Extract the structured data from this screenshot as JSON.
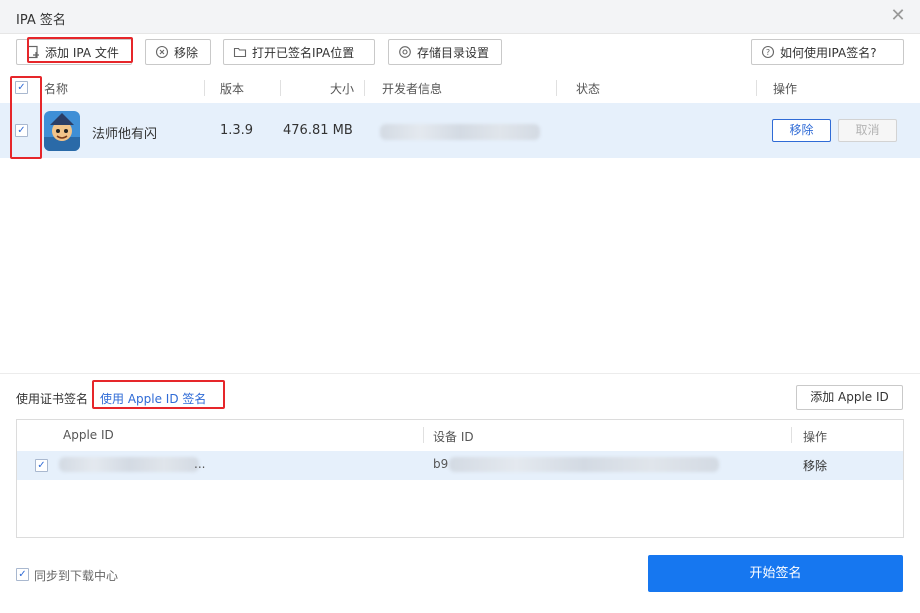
{
  "window": {
    "title": "IPA 签名"
  },
  "toolbar": {
    "add_ipa": "添加 IPA 文件",
    "remove": "移除",
    "open_signed": "打开已签名IPA位置",
    "storage_settings": "存储目录设置",
    "help": "如何使用IPA签名?"
  },
  "table": {
    "columns": [
      "名称",
      "版本",
      "大小",
      "开发者信息",
      "状态",
      "操作"
    ],
    "rows": [
      {
        "name": "法师他有闪",
        "version": "1.3.9",
        "size": "476.81 MB",
        "developer": "",
        "status": "",
        "remove": "移除",
        "cancel": "取消",
        "checked": true
      }
    ]
  },
  "signing": {
    "cert_label": "使用证书签名",
    "appleid_tab": "使用 Apple ID 签名",
    "add_appleid": "添加 Apple ID",
    "columns": [
      "Apple ID",
      "设备 ID",
      "操作"
    ],
    "rows": [
      {
        "apple_id": "...",
        "device_id_visible_start": "b9",
        "action": "移除",
        "checked": true
      }
    ]
  },
  "footer": {
    "sync_label": "同步到下载中心",
    "start": "开始签名"
  },
  "colors": {
    "accent": "#1677f0",
    "highlight": "#e6262a",
    "row_selected": "#e6f0fb"
  },
  "icons": [
    "close-icon",
    "add-file-icon",
    "remove-circle-icon",
    "folder-icon",
    "settings-icon",
    "help-icon",
    "app-icon",
    "checkbox-icon"
  ]
}
